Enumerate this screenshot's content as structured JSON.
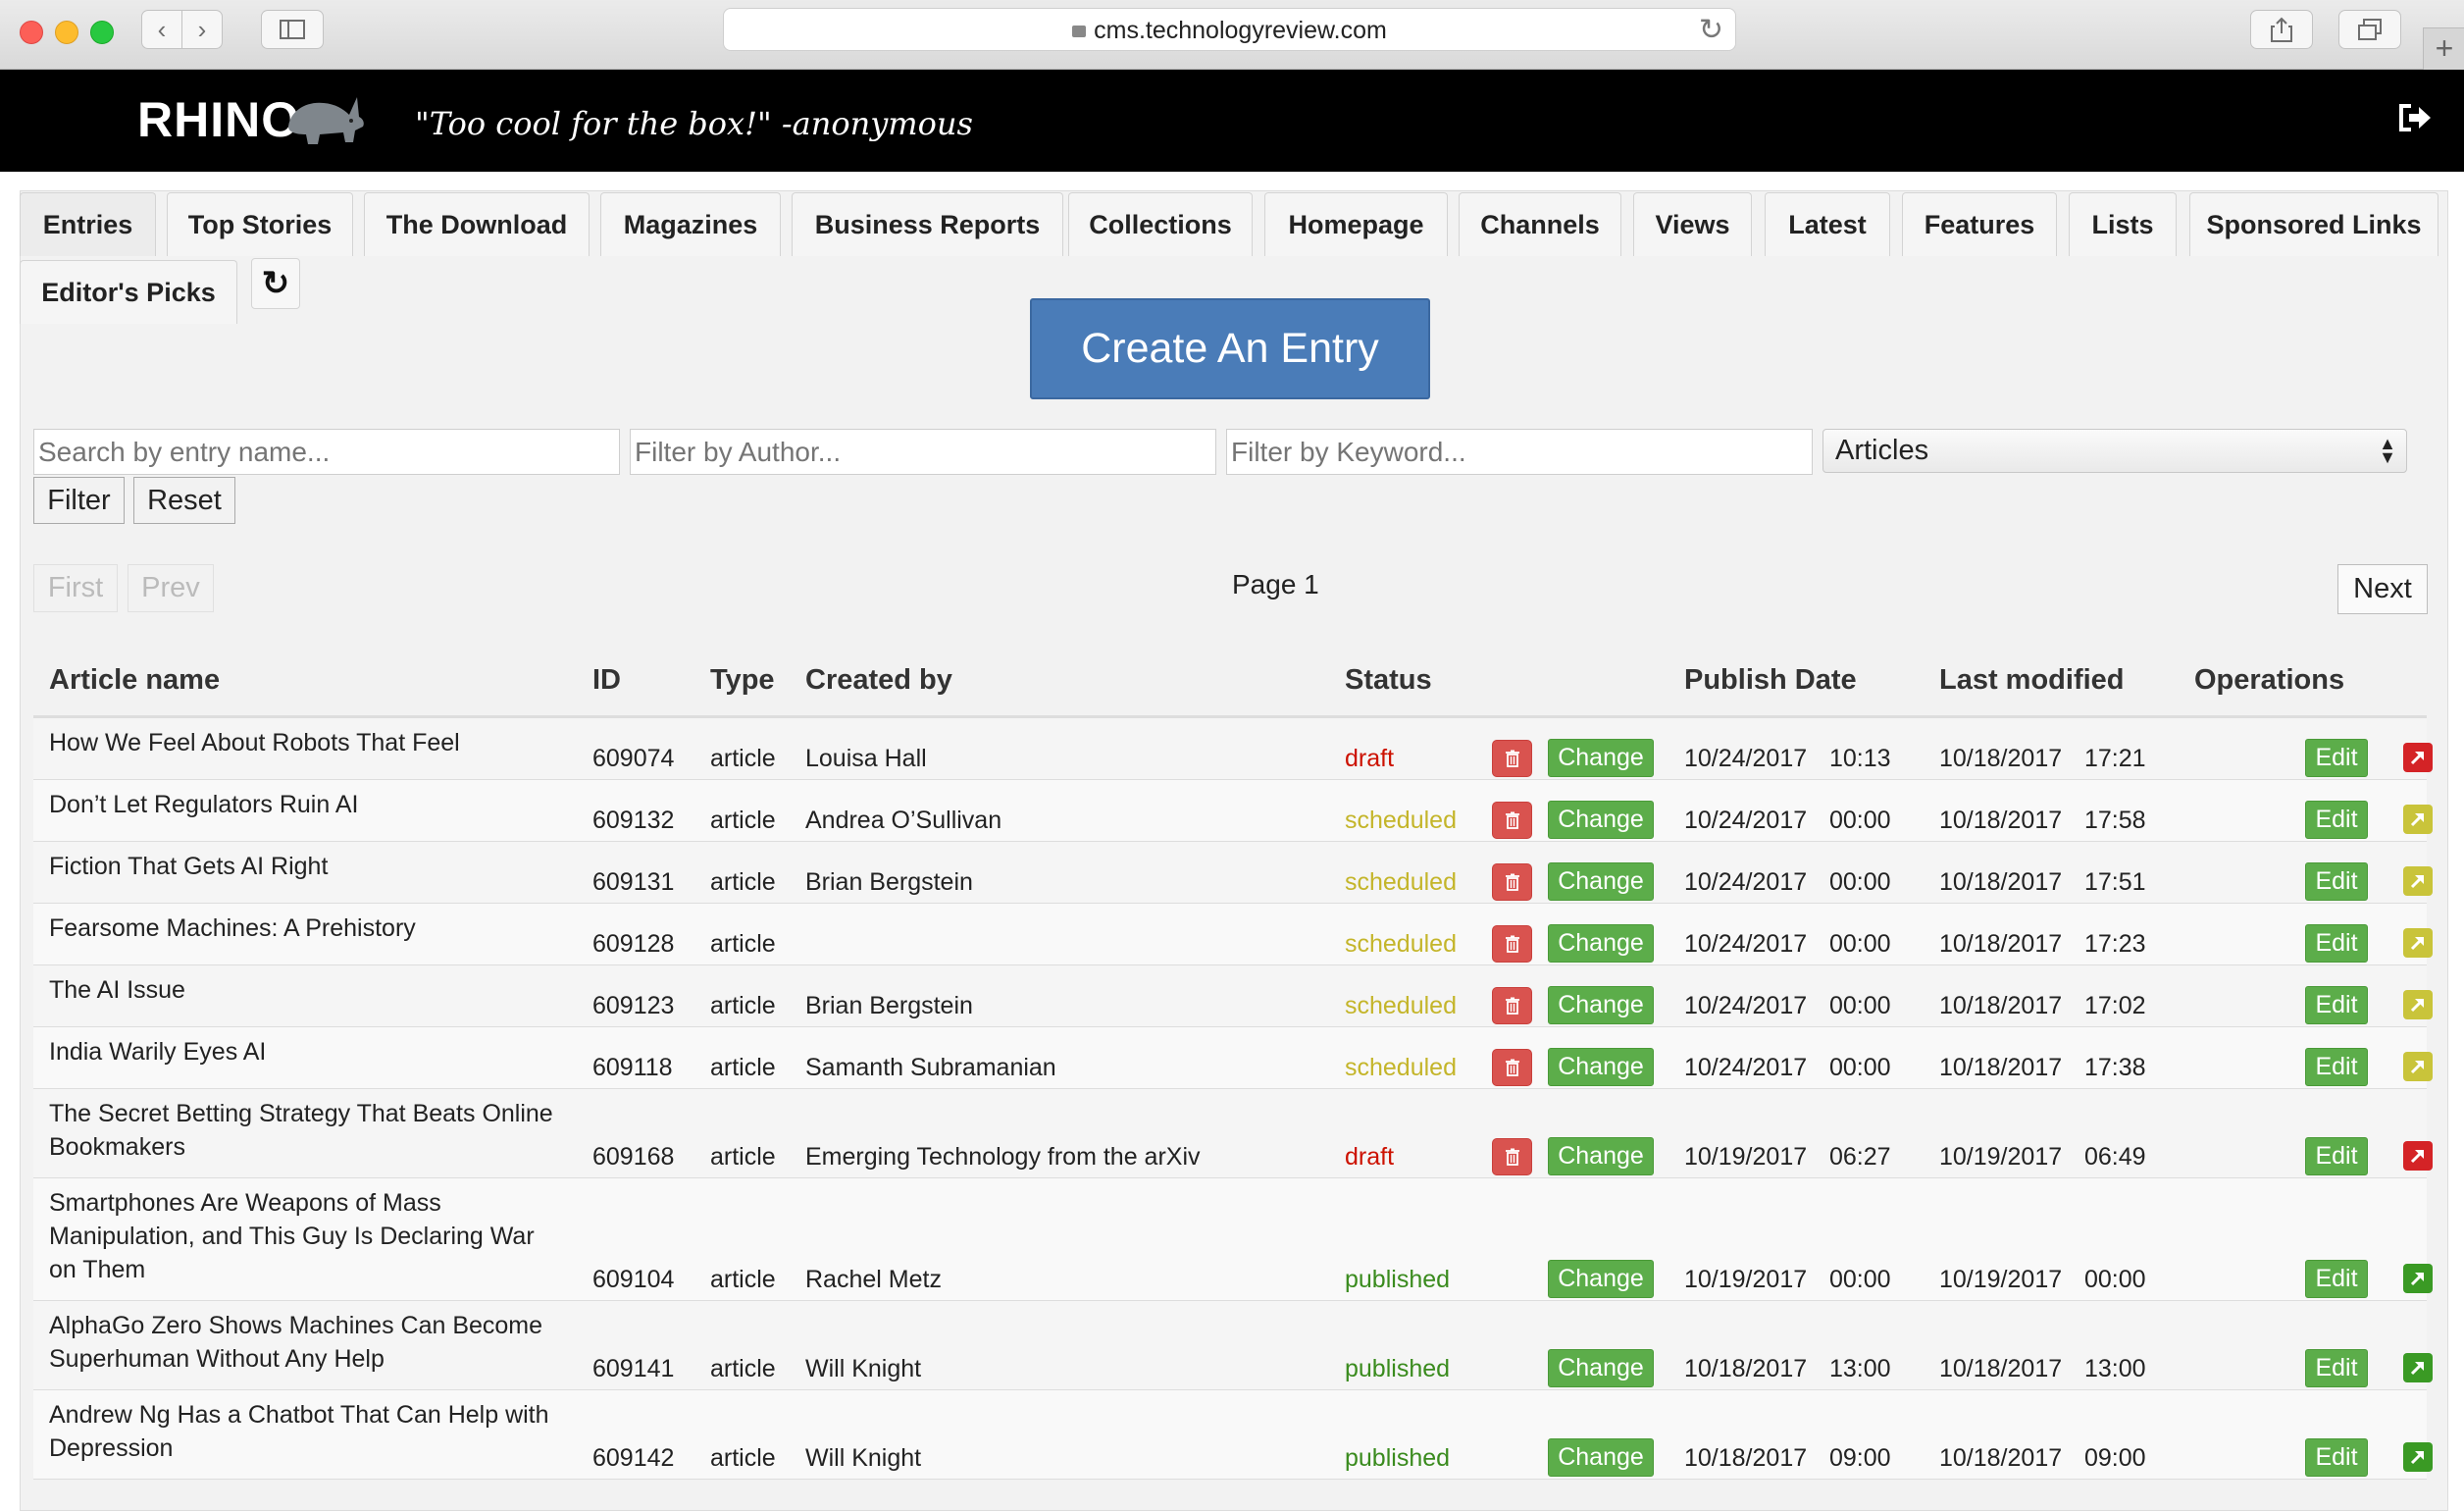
{
  "browser": {
    "url": "cms.technologyreview.com"
  },
  "app": {
    "logo": "RHINO",
    "tagline": "\"Too cool for the box!\" -anonymous"
  },
  "tabs": [
    {
      "label": "Entries",
      "active": true
    },
    {
      "label": "Top Stories"
    },
    {
      "label": "The Download"
    },
    {
      "label": "Magazines"
    },
    {
      "label": "Business Reports"
    },
    {
      "label": "Collections"
    },
    {
      "label": "Homepage"
    },
    {
      "label": "Channels"
    },
    {
      "label": "Views"
    },
    {
      "label": "Latest"
    },
    {
      "label": "Features"
    },
    {
      "label": "Lists"
    },
    {
      "label": "Sponsored Links"
    },
    {
      "label": "Editor's Picks"
    }
  ],
  "create_button": "Create An Entry",
  "filters": {
    "search_placeholder": "Search by entry name...",
    "author_placeholder": "Filter by Author...",
    "keyword_placeholder": "Filter by Keyword...",
    "type_selected": "Articles",
    "filter_label": "Filter",
    "reset_label": "Reset"
  },
  "pagination": {
    "first": "First",
    "prev": "Prev",
    "page": "Page 1",
    "next": "Next"
  },
  "table": {
    "headers": [
      "Article name",
      "ID",
      "Type",
      "Created by",
      "Status",
      "Publish Date",
      "Last modified",
      "Operations"
    ],
    "change_label": "Change",
    "edit_label": "Edit",
    "rows": [
      {
        "name": "How We Feel About Robots That Feel",
        "id": "609074",
        "type": "article",
        "author": "Louisa Hall",
        "status": "draft",
        "pub_date": "10/24/2017",
        "pub_time": "10:13",
        "mod_date": "10/18/2017",
        "mod_time": "17:21",
        "deletable": true,
        "ext": "red"
      },
      {
        "name": "Don’t Let Regulators Ruin AI",
        "id": "609132",
        "type": "article",
        "author": "Andrea O’Sullivan",
        "status": "scheduled",
        "pub_date": "10/24/2017",
        "pub_time": "00:00",
        "mod_date": "10/18/2017",
        "mod_time": "17:58",
        "deletable": true,
        "ext": "yellow"
      },
      {
        "name": "Fiction That Gets AI Right",
        "id": "609131",
        "type": "article",
        "author": "Brian Bergstein",
        "status": "scheduled",
        "pub_date": "10/24/2017",
        "pub_time": "00:00",
        "mod_date": "10/18/2017",
        "mod_time": "17:51",
        "deletable": true,
        "ext": "yellow"
      },
      {
        "name": "Fearsome Machines: A Prehistory",
        "id": "609128",
        "type": "article",
        "author": "",
        "status": "scheduled",
        "pub_date": "10/24/2017",
        "pub_time": "00:00",
        "mod_date": "10/18/2017",
        "mod_time": "17:23",
        "deletable": true,
        "ext": "yellow"
      },
      {
        "name": "The AI Issue",
        "id": "609123",
        "type": "article",
        "author": "Brian Bergstein",
        "status": "scheduled",
        "pub_date": "10/24/2017",
        "pub_time": "00:00",
        "mod_date": "10/18/2017",
        "mod_time": "17:02",
        "deletable": true,
        "ext": "yellow"
      },
      {
        "name": "India Warily Eyes AI",
        "id": "609118",
        "type": "article",
        "author": "Samanth Subramanian",
        "status": "scheduled",
        "pub_date": "10/24/2017",
        "pub_time": "00:00",
        "mod_date": "10/18/2017",
        "mod_time": "17:38",
        "deletable": true,
        "ext": "yellow"
      },
      {
        "name": "The Secret Betting Strategy That Beats Online Bookmakers",
        "id": "609168",
        "type": "article",
        "author": "Emerging Technology from the arXiv",
        "status": "draft",
        "pub_date": "10/19/2017",
        "pub_time": "06:27",
        "mod_date": "10/19/2017",
        "mod_time": "06:49",
        "deletable": true,
        "ext": "red"
      },
      {
        "name": "Smartphones Are Weapons of Mass Manipulation, and This Guy Is Declaring War on Them",
        "id": "609104",
        "type": "article",
        "author": "Rachel Metz",
        "status": "published",
        "pub_date": "10/19/2017",
        "pub_time": "00:00",
        "mod_date": "10/19/2017",
        "mod_time": "00:00",
        "deletable": false,
        "ext": "green"
      },
      {
        "name": "AlphaGo Zero Shows Machines Can Become Superhuman Without Any Help",
        "id": "609141",
        "type": "article",
        "author": "Will Knight",
        "status": "published",
        "pub_date": "10/18/2017",
        "pub_time": "13:00",
        "mod_date": "10/18/2017",
        "mod_time": "13:00",
        "deletable": false,
        "ext": "green"
      },
      {
        "name": "Andrew Ng Has a Chatbot That Can Help with Depression",
        "id": "609142",
        "type": "article",
        "author": "Will Knight",
        "status": "published",
        "pub_date": "10/18/2017",
        "pub_time": "09:00",
        "mod_date": "10/18/2017",
        "mod_time": "09:00",
        "deletable": false,
        "ext": "green"
      }
    ]
  },
  "colors": {
    "accent": "#4a7cb8",
    "success": "#5cad4a",
    "danger": "#d9534f",
    "draft": "#cc1100",
    "scheduled": "#c4b52a",
    "published": "#3a8b1e"
  }
}
